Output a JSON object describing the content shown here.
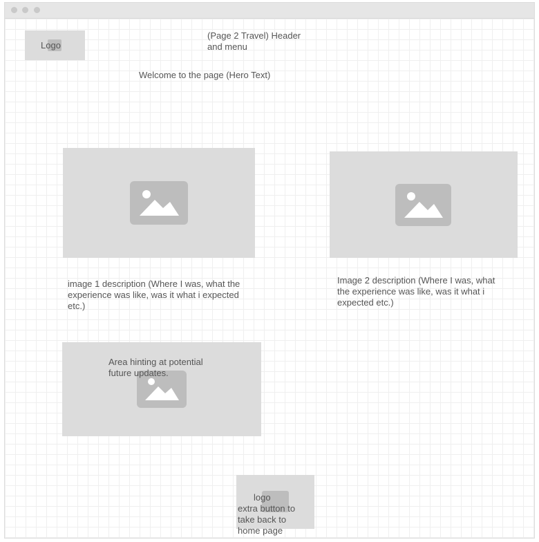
{
  "header": {
    "logo_label": "Logo",
    "header_menu_text": "(Page 2 Travel) Header\nand menu"
  },
  "hero": {
    "text": "Welcome to the page (Hero Text)"
  },
  "gallery": {
    "image1_description": "image 1 description (Where I was, what the\nexperience was like, was it what i expected\netc.)",
    "image2_description": "Image 2 description (Where I was, what\nthe experience was like, was it what i\nexpected etc.)"
  },
  "future": {
    "text": "Area hinting at potential\nfuture updates."
  },
  "footer": {
    "logo_label": "logo",
    "button_text": "extra button to\ntake back to\nhome page"
  },
  "icons": {
    "image_placeholder": "image-icon"
  },
  "colors": {
    "placeholder_fill": "#dcdcdc",
    "icon_fill": "#bdbdbd",
    "grid_line": "#efefef",
    "text": "#555555"
  }
}
